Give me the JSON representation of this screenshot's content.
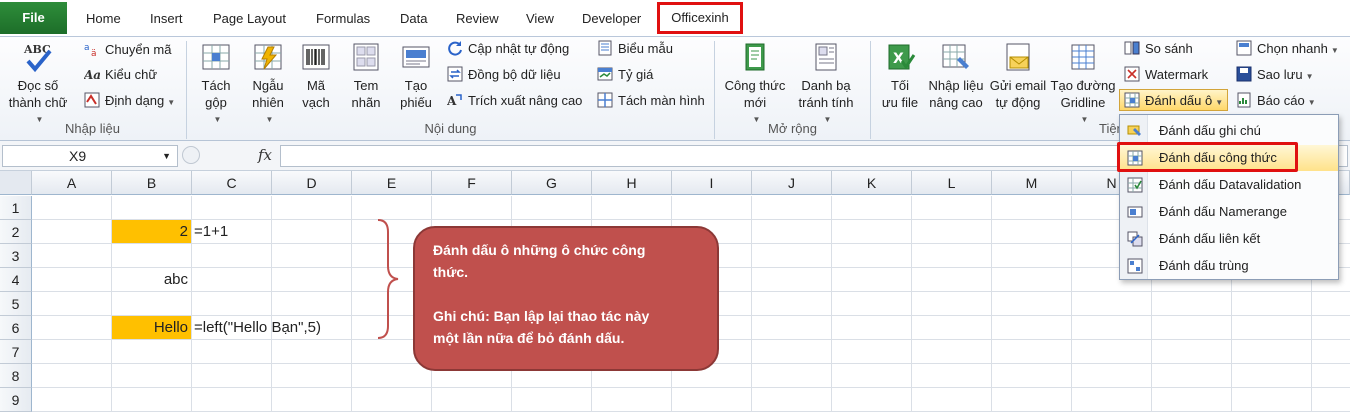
{
  "tabs": {
    "file": "File",
    "home": "Home",
    "insert": "Insert",
    "page_layout": "Page Layout",
    "formulas": "Formulas",
    "data": "Data",
    "review": "Review",
    "view": "View",
    "developer": "Developer",
    "officexinh": "Officexinh"
  },
  "ribbon": {
    "g1": {
      "label": "Nhập liệu",
      "doc_so": [
        "Đọc số",
        "thành chữ"
      ],
      "chuyen_ma": "Chuyển mã",
      "kieu_chu": "Kiểu chữ",
      "dinh_dang": "Định dạng"
    },
    "g2": {
      "label": "Nội dung",
      "tach_gop": [
        "Tách",
        "gộp"
      ],
      "ngau_nhien": [
        "Ngẫu",
        "nhiên"
      ],
      "ma_vach": [
        "Mã",
        "vạch"
      ],
      "tem_nhan": [
        "Tem",
        "nhãn"
      ],
      "tao_phieu": [
        "Tạo",
        "phiếu"
      ],
      "cap_nhat": "Cập nhật tự động",
      "dong_bo": "Đồng bộ dữ liệu",
      "trich_xuat": "Trích xuất nâng cao",
      "bieu_mau": "Biểu mẫu",
      "ty_gia": "Tỷ giá",
      "tach_man_hinh": "Tách màn hình"
    },
    "g3": {
      "label": "Mở rộng",
      "cong_thuc_moi": [
        "Công thức",
        "mới"
      ],
      "danh_ba": [
        "Danh bạ",
        "tránh tính"
      ]
    },
    "g4": {
      "label": "Tiện í",
      "toi_uu": [
        "Tối",
        "ưu file"
      ],
      "nhap_lieu": [
        "Nhập liệu",
        "nâng cao"
      ],
      "gui_email": [
        "Gửi email",
        "tự động"
      ],
      "tao_duong": [
        "Tạo đường",
        "Gridline"
      ],
      "so_sanh": "So sánh",
      "watermark": "Watermark",
      "danh_dau_o": "Đánh dấu ô",
      "chon_nhanh": "Chọn nhanh",
      "sao_luu": "Sao lưu",
      "bao_cao": "Báo cáo"
    }
  },
  "formula_bar": {
    "name_box": "X9",
    "fx": "fx",
    "formula": ""
  },
  "sheet": {
    "columns": [
      "A",
      "B",
      "C",
      "D",
      "E",
      "F",
      "G",
      "H",
      "I",
      "J",
      "K",
      "L",
      "M",
      "N"
    ],
    "rows": [
      "1",
      "2",
      "3",
      "4",
      "5",
      "6",
      "7",
      "8",
      "9"
    ],
    "cells": {
      "b2": "2",
      "c2": "=1+1",
      "b4": "abc",
      "b6": "Hello",
      "c6": "=left(\"Hello Bạn\",5)"
    },
    "highlight_color": "#ffc000"
  },
  "callout": {
    "line1": "Đánh dấu ô những ô chức công",
    "line2": "thức.",
    "line3": "Ghi chú: Bạn lập lại thao tác này",
    "line4": "một lần nữa để bỏ đánh dấu.",
    "color": "#c0504d"
  },
  "dropdown": {
    "items": [
      "Đánh dấu ghi chú",
      "Đánh dấu công thức",
      "Đánh dấu Datavalidation",
      "Đánh dấu Namerange",
      "Đánh dấu liên kết",
      "Đánh dấu trùng"
    ]
  },
  "accent": "#e01010"
}
